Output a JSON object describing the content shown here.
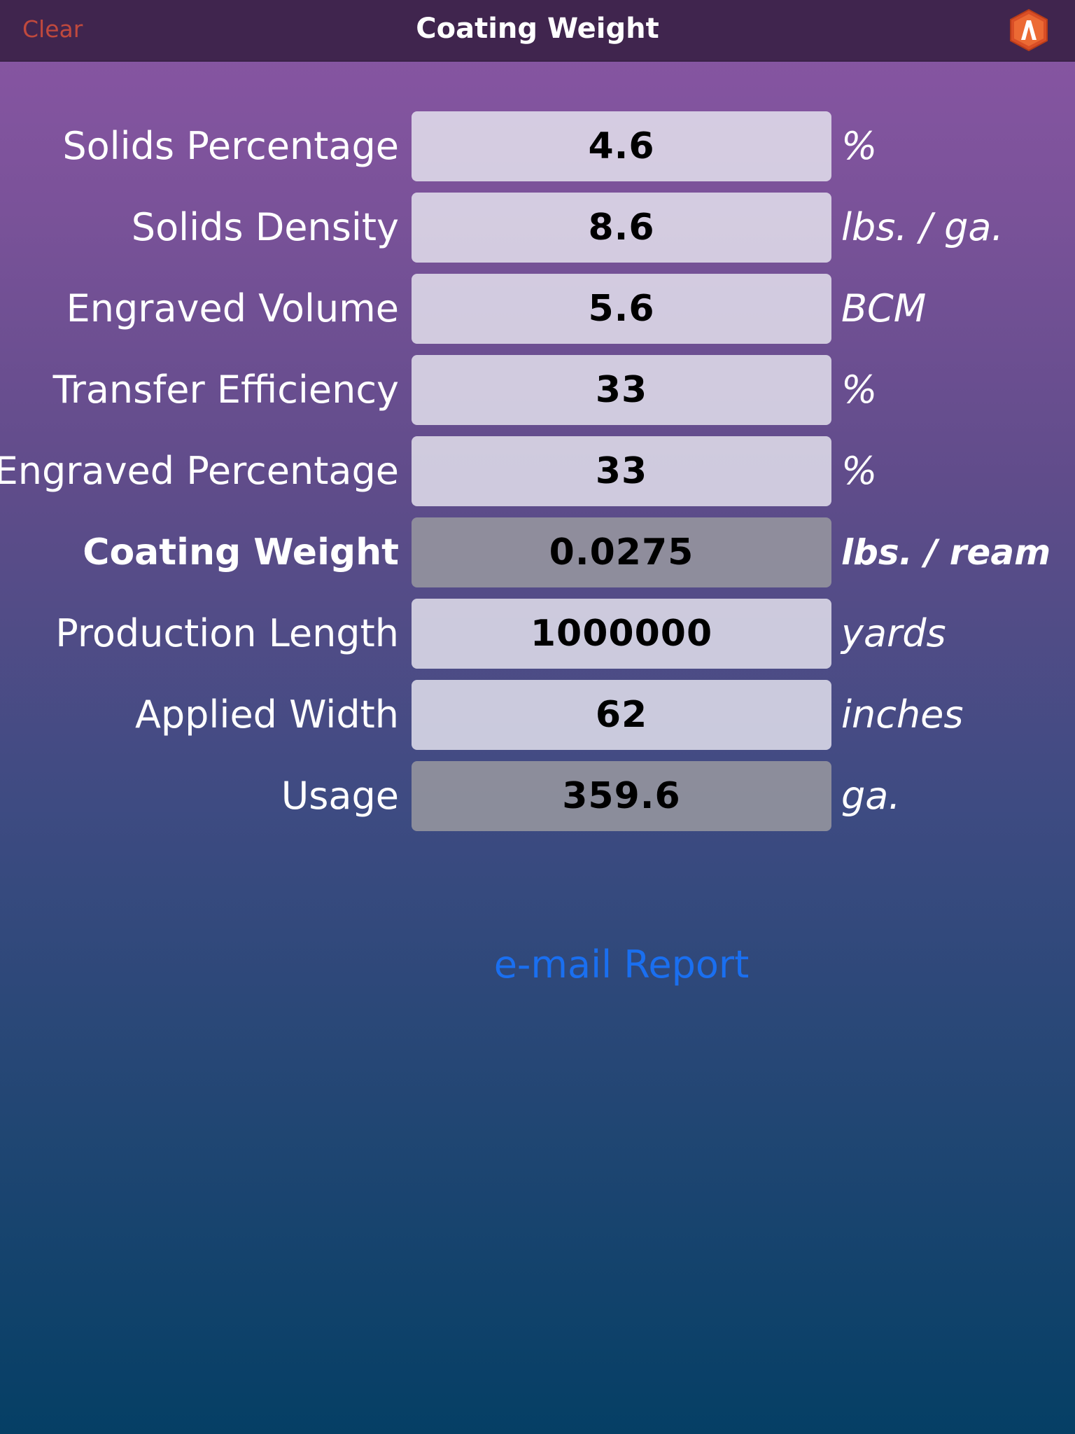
{
  "nav": {
    "clear_label": "Clear",
    "title": "Coating Weight",
    "logo_icon": "app-logo-hexagon-icon"
  },
  "rows": [
    {
      "label": "Solids Percentage",
      "value": "4.6",
      "unit": "%",
      "kind": "input"
    },
    {
      "label": "Solids Density",
      "value": "8.6",
      "unit": "lbs. / ga.",
      "kind": "input"
    },
    {
      "label": "Engraved Volume",
      "value": "5.6",
      "unit": "BCM",
      "kind": "input"
    },
    {
      "label": "Transfer Efficiency",
      "value": "33",
      "unit": "%",
      "kind": "input"
    },
    {
      "label": "Engraved Percentage",
      "value": "33",
      "unit": "%",
      "kind": "input"
    },
    {
      "label": "Coating Weight",
      "value": "0.0275",
      "unit": "lbs. / ream",
      "kind": "output"
    },
    {
      "label": "Production Length",
      "value": "1000000",
      "unit": "yards",
      "kind": "input"
    },
    {
      "label": "Applied Width",
      "value": "62",
      "unit": "inches",
      "kind": "input"
    },
    {
      "label": "Usage",
      "value": "359.6",
      "unit": "ga.",
      "kind": "output"
    }
  ],
  "email_label": "e-mail Report",
  "colors": {
    "nav_bg": "#40254e",
    "clear": "#c0493d",
    "link": "#1a6ff0",
    "logo": "#e0532a"
  }
}
